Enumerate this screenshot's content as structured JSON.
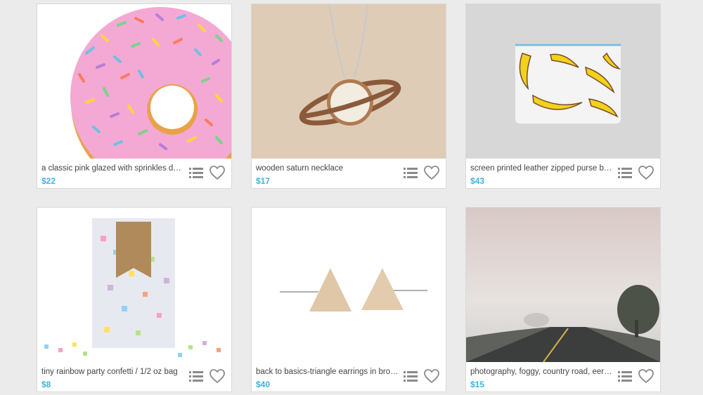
{
  "listings": [
    {
      "title": "a classic pink glazed with sprinkles donu...",
      "price": "$22",
      "image": "pink-sprinkle-donut-illustration"
    },
    {
      "title": "wooden saturn necklace",
      "price": "$17",
      "image": "wooden-saturn-pendant"
    },
    {
      "title": "screen printed leather zipped purse bag...",
      "price": "$43",
      "image": "banana-print-pouch"
    },
    {
      "title": "tiny rainbow party confetti / 1/2 oz bag",
      "price": "$8",
      "image": "confetti-bag"
    },
    {
      "title": "back to basics-triangle earrings in bronz...",
      "price": "$40",
      "image": "triangle-stud-earrings"
    },
    {
      "title": "photography, foggy, country road, eerie,...",
      "price": "$15",
      "image": "foggy-road-photo"
    }
  ],
  "icons": {
    "list": "list-icon",
    "favorite": "heart-outline-icon"
  },
  "colors": {
    "price": "#3cb4e0",
    "background": "#ebebeb",
    "icon": "#8a8a8a"
  }
}
